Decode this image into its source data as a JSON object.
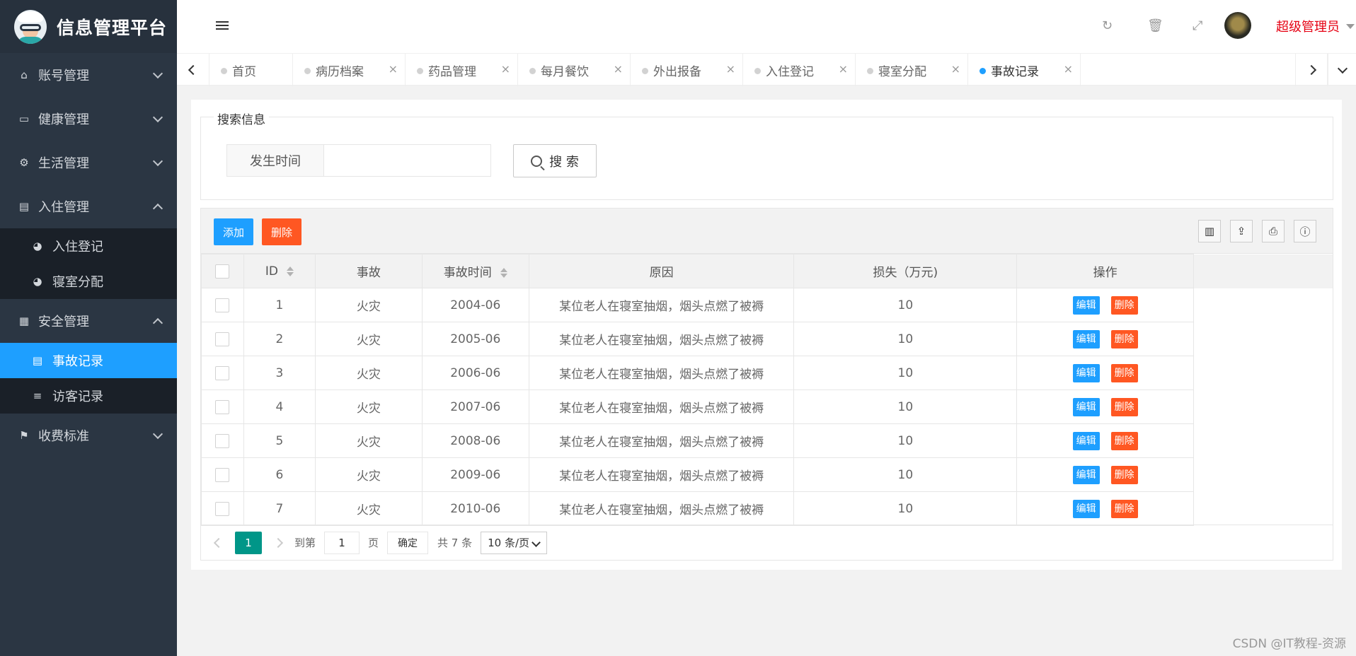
{
  "app": {
    "title": "信息管理平台"
  },
  "sidebar": {
    "items": [
      {
        "label": "账号管理",
        "icon": "home-icon",
        "expanded": false
      },
      {
        "label": "健康管理",
        "icon": "window-icon",
        "expanded": false
      },
      {
        "label": "生活管理",
        "icon": "gears-icon",
        "expanded": false
      },
      {
        "label": "入住管理",
        "icon": "file-icon",
        "expanded": true,
        "children": [
          "入住登记",
          "寝室分配"
        ]
      },
      {
        "label": "安全管理",
        "icon": "calendar-icon",
        "expanded": true,
        "children": [
          "事故记录",
          "访客记录"
        ]
      },
      {
        "label": "收费标准",
        "icon": "flag-icon",
        "expanded": false
      }
    ],
    "active_child": "事故记录"
  },
  "header": {
    "user": "超级管理员",
    "icons": [
      "refresh-icon",
      "trash-icon",
      "fullscreen-icon"
    ]
  },
  "tabs": [
    "首页",
    "病历档案",
    "药品管理",
    "每月餐饮",
    "外出报备",
    "入住登记",
    "寝室分配",
    "事故记录"
  ],
  "active_tab": "事故记录",
  "search": {
    "legend": "搜索信息",
    "field_label": "发生时间",
    "field_value": "",
    "button": "搜 索"
  },
  "toolbar": {
    "add": "添加",
    "delete": "删除"
  },
  "table": {
    "columns": [
      "ID",
      "事故",
      "事故时间",
      "原因",
      "损失（万元)",
      "操作"
    ],
    "rows": [
      {
        "id": "1",
        "type": "火灾",
        "time": "2004-06",
        "reason": "某位老人在寝室抽烟，烟头点燃了被褥",
        "loss": "10"
      },
      {
        "id": "2",
        "type": "火灾",
        "time": "2005-06",
        "reason": "某位老人在寝室抽烟，烟头点燃了被褥",
        "loss": "10"
      },
      {
        "id": "3",
        "type": "火灾",
        "time": "2006-06",
        "reason": "某位老人在寝室抽烟，烟头点燃了被褥",
        "loss": "10"
      },
      {
        "id": "4",
        "type": "火灾",
        "time": "2007-06",
        "reason": "某位老人在寝室抽烟，烟头点燃了被褥",
        "loss": "10"
      },
      {
        "id": "5",
        "type": "火灾",
        "time": "2008-06",
        "reason": "某位老人在寝室抽烟，烟头点燃了被褥",
        "loss": "10"
      },
      {
        "id": "6",
        "type": "火灾",
        "time": "2009-06",
        "reason": "某位老人在寝室抽烟，烟头点燃了被褥",
        "loss": "10"
      },
      {
        "id": "7",
        "type": "火灾",
        "time": "2010-06",
        "reason": "某位老人在寝室抽烟，烟头点燃了被褥",
        "loss": "10"
      }
    ],
    "row_actions": {
      "edit": "编辑",
      "delete": "删除"
    }
  },
  "pagination": {
    "current": "1",
    "goto_label": "到第",
    "goto_value": "1",
    "page_unit": "页",
    "confirm": "确定",
    "total": "共 7 条",
    "page_size": "10 条/页"
  },
  "watermark": "CSDN @IT教程-资源",
  "colors": {
    "primary": "#1e9fff",
    "danger": "#ff5722",
    "sidebar": "#2b3643",
    "page_active": "#009688",
    "user": "#e60012"
  }
}
